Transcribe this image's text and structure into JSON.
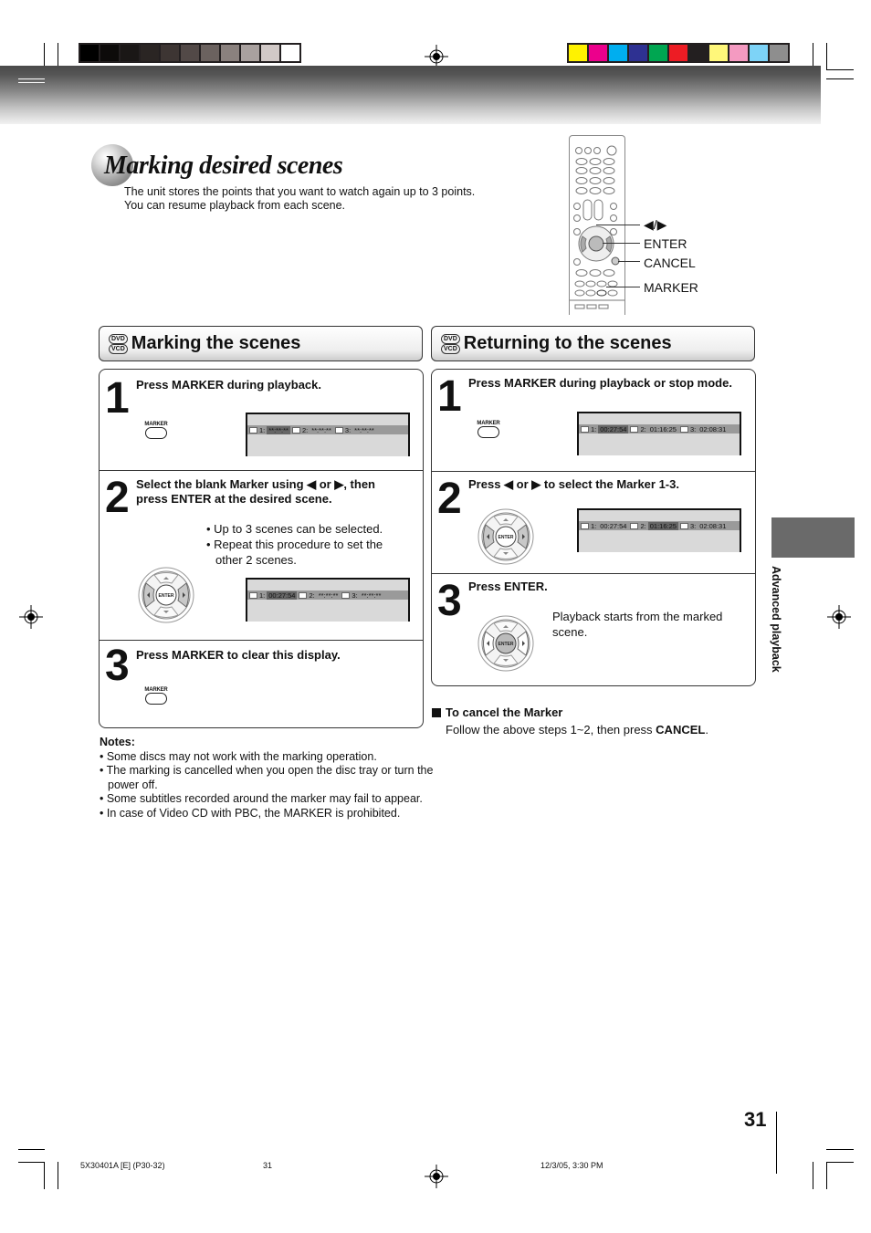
{
  "header": {
    "gray_swatches": [
      "#000000",
      "#0d0b0a",
      "#1a1716",
      "#2a2523",
      "#3d3533",
      "#524947",
      "#6b625f",
      "#8a817e",
      "#a9a19f",
      "#d1c9c7",
      "#ffffff"
    ],
    "color_swatches": [
      "#fff200",
      "#ec008c",
      "#00aeef",
      "#2e3192",
      "#00a651",
      "#ed1c24",
      "#231f20",
      "#fff77a",
      "#f49ac1",
      "#7dd3f7",
      "#8e8e8e"
    ]
  },
  "page": {
    "title": "Marking desired scenes",
    "intro_line1": "The unit stores the points that you want to watch again up to 3 points.",
    "intro_line2": "You can resume playback from each scene."
  },
  "remote_labels": {
    "arrows": "◀/▶",
    "enter": "ENTER",
    "cancel": "CANCEL",
    "marker": "MARKER"
  },
  "disc_logo": {
    "top": "DVD",
    "bottom": "VCD"
  },
  "marking": {
    "heading": "Marking the scenes",
    "steps": [
      {
        "num": "1",
        "text": "Press MARKER during playback.",
        "button_label": "MARKER",
        "osd": [
          {
            "label": "1:",
            "value": "**:**:**",
            "selected": true
          },
          {
            "label": "2:",
            "value": "**:**:**",
            "selected": false
          },
          {
            "label": "3:",
            "value": "**:**:**",
            "selected": false
          }
        ]
      },
      {
        "num": "2",
        "text_line1": "Select the blank Marker using ◀ or ▶, then",
        "text_line2": "press ENTER at the desired scene.",
        "bullet1": "• Up to 3 scenes can be selected.",
        "bullet2": "• Repeat this procedure to set the",
        "bullet2b": "other 2 scenes.",
        "dpad_label": "ENTER",
        "osd": [
          {
            "label": "1:",
            "value": "00:27:54",
            "selected": true
          },
          {
            "label": "2:",
            "value": "**:**:**",
            "selected": false
          },
          {
            "label": "3:",
            "value": "**:**:**",
            "selected": false
          }
        ]
      },
      {
        "num": "3",
        "text": "Press MARKER to clear this display.",
        "button_label": "MARKER"
      }
    ]
  },
  "returning": {
    "heading": "Returning to the scenes",
    "steps": [
      {
        "num": "1",
        "text": "Press MARKER during playback or stop mode.",
        "button_label": "MARKER",
        "osd": [
          {
            "label": "1:",
            "value": "00:27:54",
            "selected": true
          },
          {
            "label": "2:",
            "value": "01:16:25",
            "selected": false
          },
          {
            "label": "3:",
            "value": "02:08:31",
            "selected": false
          }
        ]
      },
      {
        "num": "2",
        "text": "Press ◀ or ▶ to select the Marker 1-3.",
        "dpad_label": "ENTER",
        "osd": [
          {
            "label": "1:",
            "value": "00:27:54",
            "selected": false
          },
          {
            "label": "2:",
            "value": "01:16:25",
            "selected": true
          },
          {
            "label": "3:",
            "value": "02:08:31",
            "selected": false
          }
        ]
      },
      {
        "num": "3",
        "text": "Press ENTER.",
        "body_line1": "Playback starts from the marked",
        "body_line2": "scene.",
        "dpad_label": "ENTER"
      }
    ]
  },
  "cancel_note": {
    "heading": "To cancel the Marker",
    "body_prefix": "Follow the above steps 1~2, then press ",
    "body_bold": "CANCEL",
    "body_suffix": "."
  },
  "notes": {
    "heading": "Notes:",
    "items": [
      "• Some discs may not work with the marking operation.",
      "• The marking is cancelled when you open the disc tray or turn the power off.",
      "• Some subtitles recorded around the marker may fail to appear.",
      "• In case of Video CD with PBC, the MARKER is prohibited."
    ]
  },
  "side_tab": {
    "label": "Advanced playback"
  },
  "footer": {
    "page_number": "31",
    "doc_code": "5X30401A [E] (P30-32)",
    "sheet": "31",
    "date": "12/3/05, 3:30 PM"
  }
}
